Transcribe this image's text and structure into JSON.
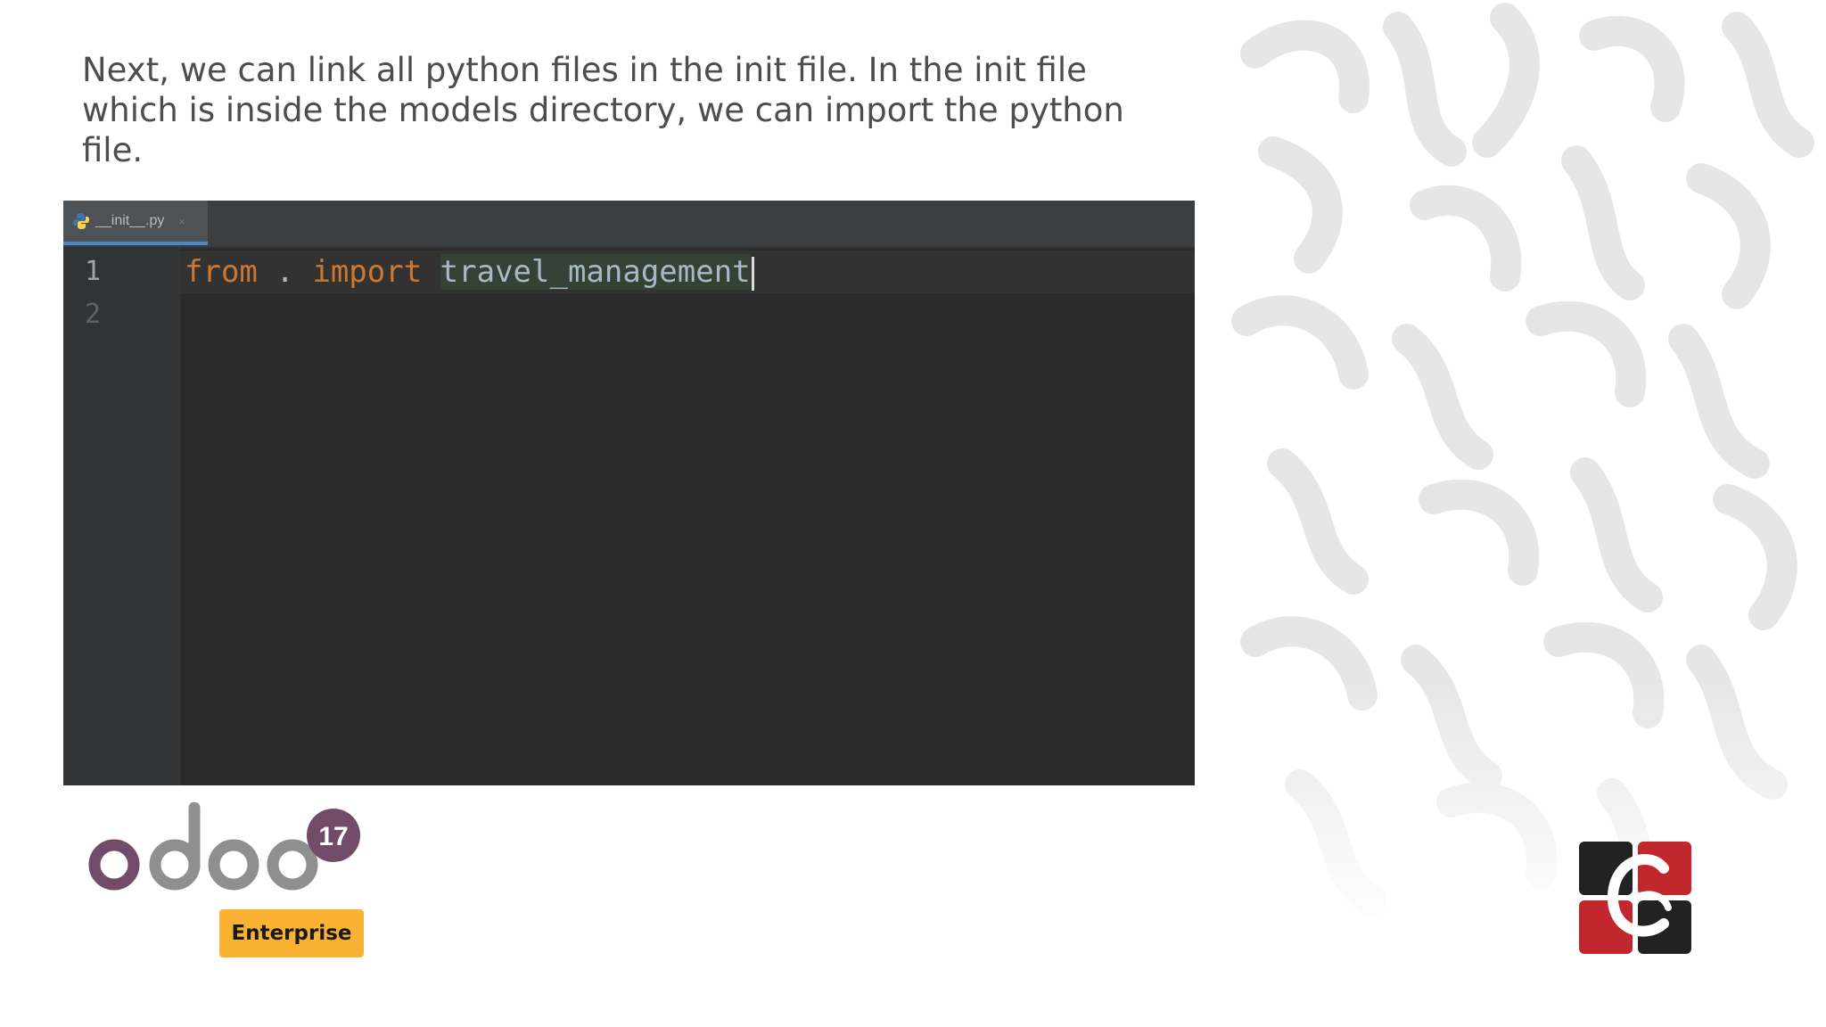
{
  "slide": {
    "caption": "Next, we can link all python files in the init file. In the init file which is inside the models directory, we can import the python file."
  },
  "editor": {
    "tab": {
      "filename": "__init__.py",
      "close_glyph": "×",
      "icon": "python-file-icon"
    },
    "line_numbers": [
      "1",
      "2"
    ],
    "code": {
      "keyword_from": "from",
      "dot": ".",
      "keyword_import": "import",
      "module": "travel_management"
    },
    "colors": {
      "background": "#2b2b2b",
      "keyword": "#cc7832",
      "identifier": "#a9b7c6",
      "active_tab_underline": "#4a88c7"
    }
  },
  "branding": {
    "product_logo": "odoo",
    "version_badge": "17",
    "edition_badge": "Enterprise",
    "company_logo": "cybrosys-logo",
    "colors": {
      "odoo_purple": "#714b67",
      "odoo_gray": "#8f8f8f",
      "badge_yellow": "#f9b234",
      "brand_red": "#c1272d"
    }
  }
}
